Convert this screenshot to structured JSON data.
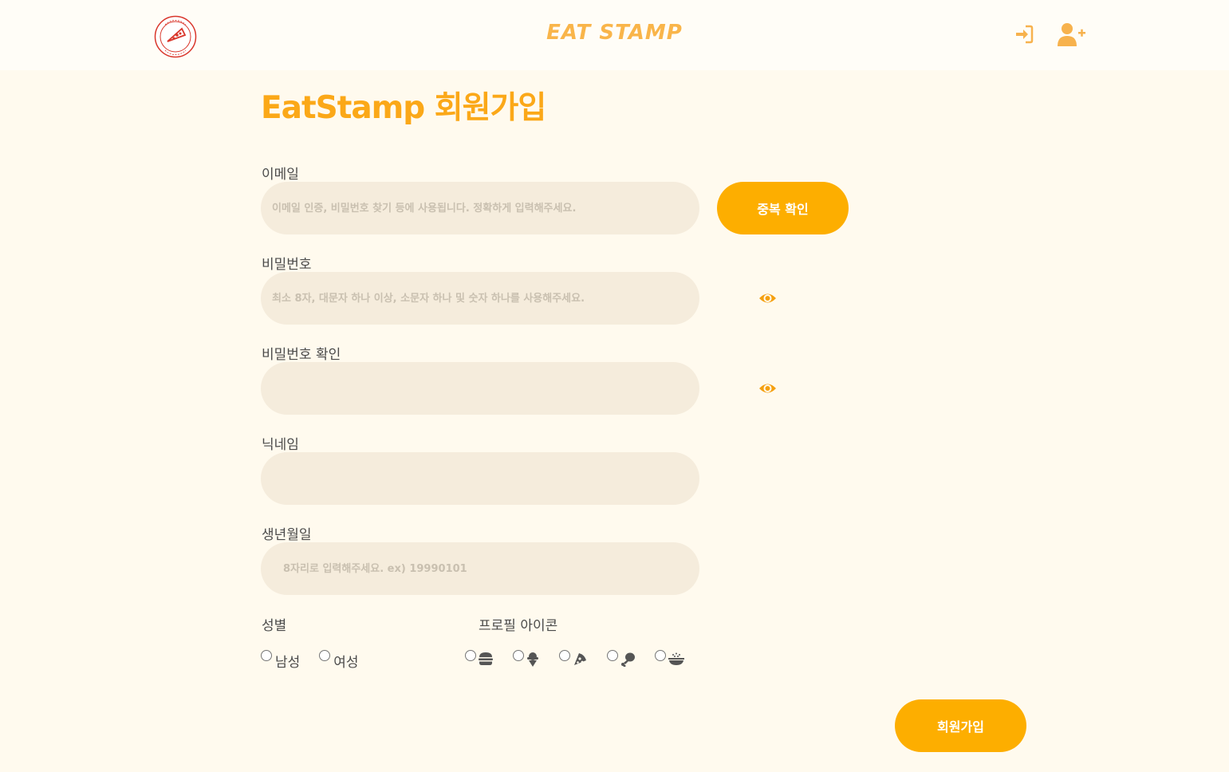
{
  "header": {
    "logo_name": "eat-stamp-logo",
    "brand": "EAT STAMP",
    "login_icon": "sign-in-icon",
    "signup_icon": "user-plus-icon",
    "accent": "#fdae00",
    "brand_color": "#f9b54a"
  },
  "page": {
    "title": "EatStamp 회원가입"
  },
  "form": {
    "email": {
      "label": "이메일",
      "placeholder": "이메일 인증, 비밀번호 찾기 등에 사용됩니다. 정확하게 입력해주세요.",
      "button": "중복 확인"
    },
    "password": {
      "label": "비밀번호",
      "placeholder": "최소 8자, 대문자 하나 이상, 소문자 하나 및 숫자 하나를 사용해주세요.",
      "toggle_icon": "eye-icon"
    },
    "password_confirm": {
      "label": "비밀번호 확인",
      "placeholder": "",
      "toggle_icon": "eye-icon"
    },
    "nickname": {
      "label": "닉네임",
      "placeholder": ""
    },
    "birth": {
      "label": "생년월일",
      "placeholder": "8자리로 입력해주세요. ex) 19990101"
    },
    "gender": {
      "label": "성별",
      "options": [
        "남성",
        "여성"
      ]
    },
    "profile_icon": {
      "label": "프로필 아이콘",
      "options": [
        "hamburger-icon",
        "ice-cream-icon",
        "pizza-icon",
        "drumstick-icon",
        "rice-bowl-icon"
      ]
    },
    "submit": "회원가입"
  }
}
